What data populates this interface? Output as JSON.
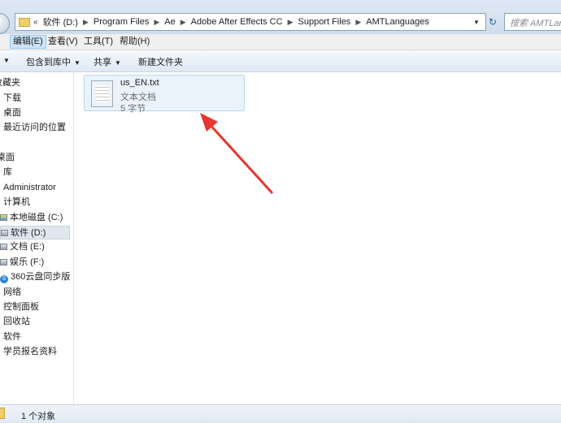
{
  "address": {
    "chevrons": "«",
    "crumbs": [
      "软件 (D:)",
      "Program Files",
      "Ae",
      "Adobe After Effects CC",
      "Support Files",
      "AMTLanguages"
    ],
    "search_placeholder": "搜索 AMTLanguages"
  },
  "menu": {
    "edit": "编辑(E)",
    "view": "查看(V)",
    "tools": "工具(T)",
    "help": "帮助(H)"
  },
  "toolbar": {
    "include_in_library": "包含到库中",
    "share": "共享",
    "new_folder": "新建文件夹"
  },
  "nav": {
    "favorites": "收藏夹",
    "downloads": "下载",
    "desktop_fav": "桌面",
    "recent": "最近访问的位置",
    "desktop": "桌面",
    "libraries": "库",
    "administrator": "Administrator",
    "computer": "计算机",
    "drive_c": "本地磁盘 (C:)",
    "drive_d": "软件 (D:)",
    "drive_e": "文档 (E:)",
    "drive_f": "娱乐 (F:)",
    "cloud": "360云盘同步版",
    "network": "网络",
    "control_panel": "控制面板",
    "recycle_bin": "回收站",
    "software": "软件",
    "student_files": "学员报名资料"
  },
  "file": {
    "name": "us_EN.txt",
    "type": "文本文档",
    "size": "5 字节"
  },
  "status": {
    "count": "1 个对象"
  },
  "colors": {
    "annotation_arrow": "#e8352d",
    "selection": "#eaf3fc"
  }
}
